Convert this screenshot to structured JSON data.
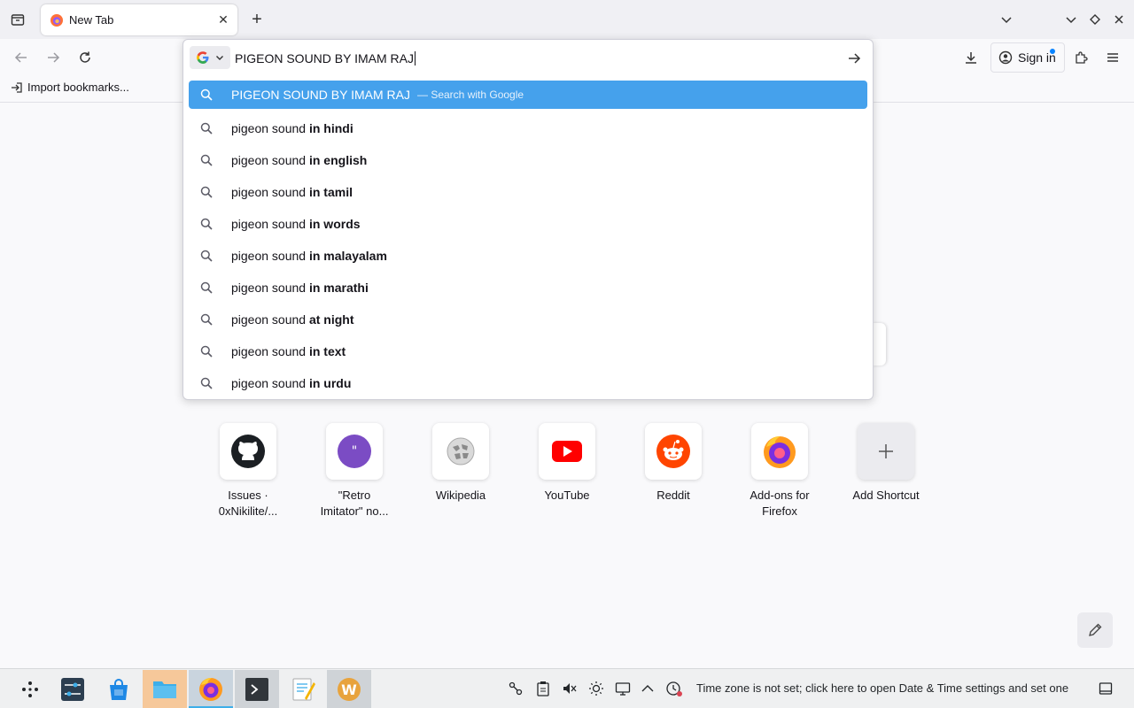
{
  "tab": {
    "title": "New Tab"
  },
  "urlbar": {
    "value": "PIGEON SOUND BY IMAM RAJ",
    "selected": {
      "text": "PIGEON SOUND BY IMAM RAJ",
      "hint": "—  Search with Google"
    },
    "suggestions": [
      {
        "prefix": "pigeon sound ",
        "bold": "in hindi"
      },
      {
        "prefix": "pigeon sound ",
        "bold": "in english"
      },
      {
        "prefix": "pigeon sound ",
        "bold": "in tamil"
      },
      {
        "prefix": "pigeon sound ",
        "bold": "in words"
      },
      {
        "prefix": "pigeon sound ",
        "bold": "in malayalam"
      },
      {
        "prefix": "pigeon sound ",
        "bold": "in marathi"
      },
      {
        "prefix": "pigeon sound ",
        "bold": "at night"
      },
      {
        "prefix": "pigeon sound ",
        "bold": "in text"
      },
      {
        "prefix": "pigeon sound ",
        "bold": "in urdu"
      }
    ]
  },
  "toolbar": {
    "signin_label": "Sign in"
  },
  "bookmarks": {
    "import_label": "Import bookmarks..."
  },
  "shortcuts": [
    {
      "line1": "Issues ·",
      "line2": "0xNikilite/...",
      "icon": "github-icon"
    },
    {
      "line1": "\"Retro",
      "line2": "Imitator\" no...",
      "icon": "retro-imitator-icon"
    },
    {
      "line1": "Wikipedia",
      "line2": "",
      "icon": "wikipedia-icon"
    },
    {
      "line1": "YouTube",
      "line2": "",
      "icon": "youtube-icon"
    },
    {
      "line1": "Reddit",
      "line2": "",
      "icon": "reddit-icon"
    },
    {
      "line1": "Add-ons for",
      "line2": "Firefox",
      "icon": "firefox-addons-icon"
    },
    {
      "line1": "Add Shortcut",
      "line2": "",
      "icon": "plus-icon"
    }
  ],
  "taskbar": {
    "timezone_text": "Time zone is not set; click here to open Date & Time settings and set one"
  },
  "colors": {
    "selected_row": "#45a1ec",
    "accent": "#0a84ff"
  }
}
